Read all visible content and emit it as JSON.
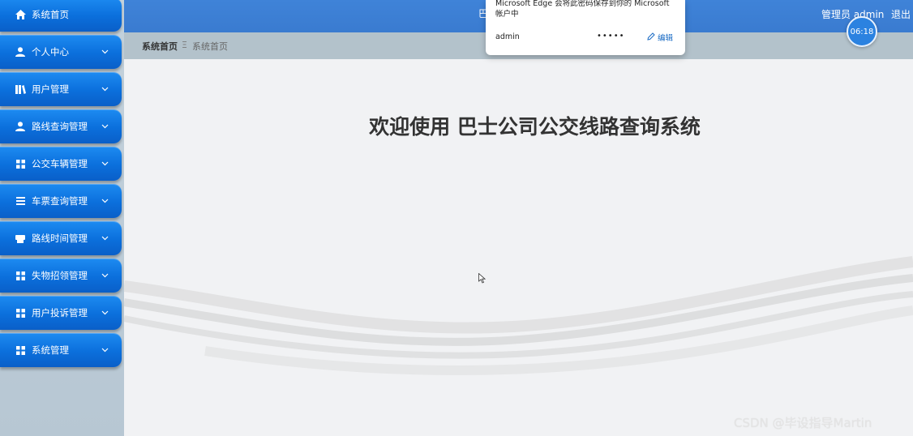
{
  "sidebar": {
    "items": [
      {
        "label": "系统首页",
        "icon": "home-icon",
        "has_chevron": false
      },
      {
        "label": "个人中心",
        "icon": "user-icon",
        "has_chevron": true
      },
      {
        "label": "用户管理",
        "icon": "book-icon",
        "has_chevron": true
      },
      {
        "label": "路线查询管理",
        "icon": "user-icon",
        "has_chevron": true
      },
      {
        "label": "公交车辆管理",
        "icon": "grid-icon",
        "has_chevron": true
      },
      {
        "label": "车票查询管理",
        "icon": "list-icon",
        "has_chevron": true
      },
      {
        "label": "路线时间管理",
        "icon": "printer-icon",
        "has_chevron": true
      },
      {
        "label": "失物招领管理",
        "icon": "grid-icon",
        "has_chevron": true
      },
      {
        "label": "用户投诉管理",
        "icon": "grid-icon",
        "has_chevron": true
      },
      {
        "label": "系统管理",
        "icon": "grid-icon",
        "has_chevron": true
      }
    ]
  },
  "header": {
    "title_stub": "巴",
    "admin_label": "管理员 admin",
    "logout_label": "退出",
    "clock": "06:18"
  },
  "breadcrumb": {
    "home": "系统首页",
    "separator": "Ξ",
    "current": "系统首页"
  },
  "main": {
    "welcome": "欢迎使用 巴士公司公交线路查询系统"
  },
  "popup": {
    "message": "Microsoft Edge 会将此密码保存到你的 Microsoft 帐户中",
    "username": "admin",
    "password_mask": "•••••",
    "edit_label": "编辑"
  },
  "watermark": "CSDN @毕设指导Martin",
  "colors": {
    "nav_blue": "#0b6fdc",
    "topbar_blue": "#3f83d8",
    "link_blue": "#1a6bc4"
  }
}
